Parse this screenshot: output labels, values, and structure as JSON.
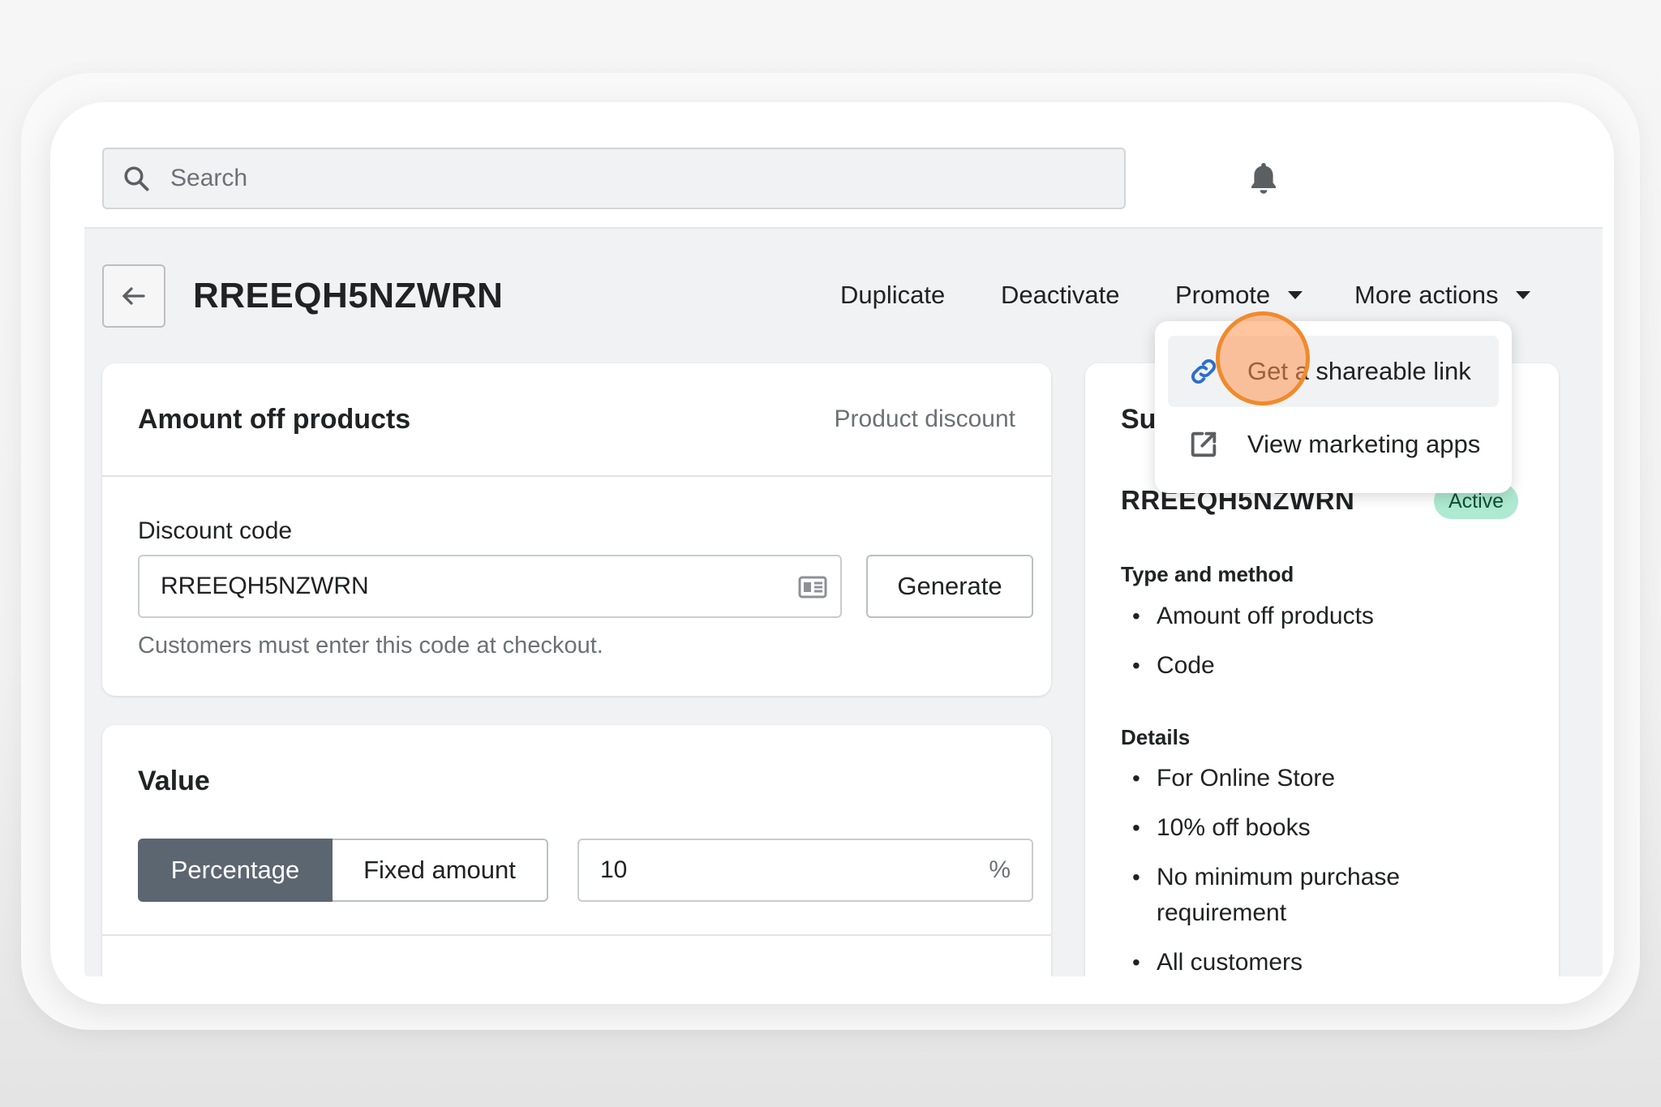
{
  "search": {
    "placeholder": "Search"
  },
  "page": {
    "title": "RREEQH5NZWRN"
  },
  "actions": {
    "duplicate": "Duplicate",
    "deactivate": "Deactivate",
    "promote": "Promote",
    "more_actions": "More actions"
  },
  "promote_menu": {
    "items": [
      {
        "label": "Get a shareable link",
        "icon": "link-icon"
      },
      {
        "label": "View marketing apps",
        "icon": "external-link-icon"
      }
    ]
  },
  "discount_card": {
    "title": "Amount off products",
    "type": "Product discount",
    "code_label": "Discount code",
    "code_value": "RREEQH5NZWRN",
    "generate_label": "Generate",
    "help": "Customers must enter this code at checkout."
  },
  "value_card": {
    "title": "Value",
    "options": [
      "Percentage",
      "Fixed amount"
    ],
    "selected": "Percentage",
    "amount": "10",
    "suffix": "%"
  },
  "summary": {
    "title_visible": "Su",
    "code": "RREEQH5NZWRN",
    "status": "Active",
    "type_heading": "Type and method",
    "type_items": [
      "Amount off products",
      "Code"
    ],
    "details_heading": "Details",
    "details_items": [
      "For Online Store",
      "10% off books",
      "No minimum purchase requirement",
      "All customers"
    ]
  },
  "colors": {
    "accent_primary": "#5c6670",
    "badge_bg": "#aee9d1",
    "link_icon": "#2c6ecb",
    "cursor_highlight": "#f08a2c"
  }
}
